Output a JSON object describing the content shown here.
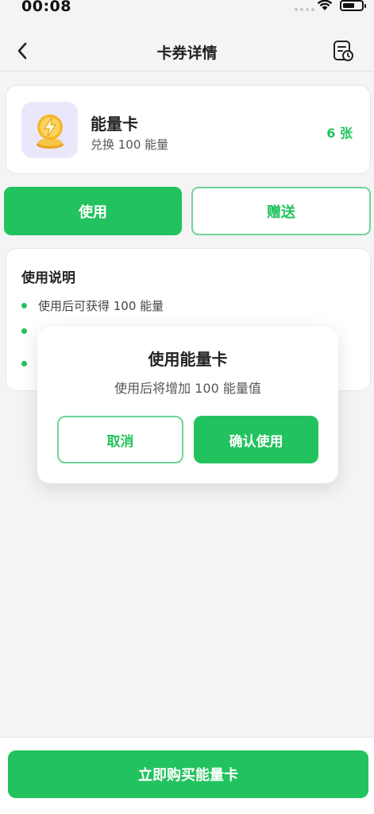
{
  "status_bar": {
    "time": "00:08"
  },
  "nav": {
    "title": "卡券详情",
    "back_icon": "chevron-left-icon",
    "record_icon": "history-record-icon"
  },
  "card": {
    "name": "能量卡",
    "desc": "兑换 100 能量",
    "count": "6 张",
    "icon": "lightning-coin-icon"
  },
  "actions": {
    "use_label": "使用",
    "gift_label": "赠送"
  },
  "instructions": {
    "title": "使用说明",
    "items": [
      "使用后可获得 100 能量"
    ]
  },
  "dialog": {
    "title": "使用能量卡",
    "message": "使用后将增加 100 能量值",
    "cancel_label": "取消",
    "confirm_label": "确认使用"
  },
  "bottom": {
    "buy_label": "立即购买能量卡"
  },
  "colors": {
    "accent": "#22c35e",
    "accent_border": "#6ed495",
    "thumb_bg": "#ebe7fb"
  }
}
